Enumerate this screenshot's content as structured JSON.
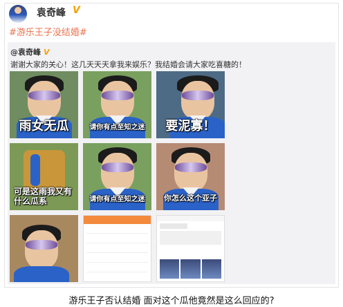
{
  "post": {
    "username": "袁奇峰",
    "verified_badge": "V",
    "hashtag": "#游乐王子没结婚#",
    "repost": {
      "author": "@袁奇峰",
      "verified_badge": "V",
      "text": "谢谢大家的关心！这几天天天拿我来娱乐？我结婚会请大家吃喜糖的！",
      "images": [
        {
          "caption": "雨女无瓜"
        },
        {
          "caption": "请你有点至知之迷"
        },
        {
          "caption": "要泥寡！"
        },
        {
          "caption": "可是这雨我又有什么瓜系"
        },
        {
          "caption": "请你有点至知之迷"
        },
        {
          "caption": "你怎么这个亚子"
        },
        {
          "caption": ""
        },
        {
          "caption": ""
        },
        {
          "caption": ""
        }
      ]
    }
  },
  "footer": {
    "caption": "游乐王子否认结婚 面对这个瓜他竟然是这么回应的?"
  },
  "colors": {
    "hashtag": "#eb7350",
    "badge": "#f2a100",
    "repost_bg": "#f2f2f5"
  }
}
